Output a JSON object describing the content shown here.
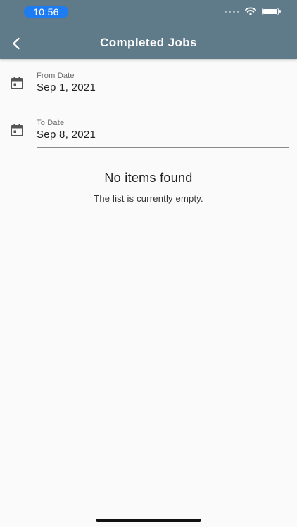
{
  "status_bar": {
    "time": "10:56"
  },
  "app_bar": {
    "title": "Completed Jobs",
    "back_icon": "chevron-left-icon"
  },
  "filters": {
    "from": {
      "label": "From Date",
      "value": "Sep 1, 2021",
      "icon": "calendar-icon"
    },
    "to": {
      "label": "To Date",
      "value": "Sep 8, 2021",
      "icon": "calendar-icon"
    }
  },
  "empty_state": {
    "title": "No items found",
    "message": "The list is currently empty."
  },
  "colors": {
    "app_bar": "#5f7a89",
    "time_pill": "#1e7cf2",
    "background": "#fafafa"
  }
}
